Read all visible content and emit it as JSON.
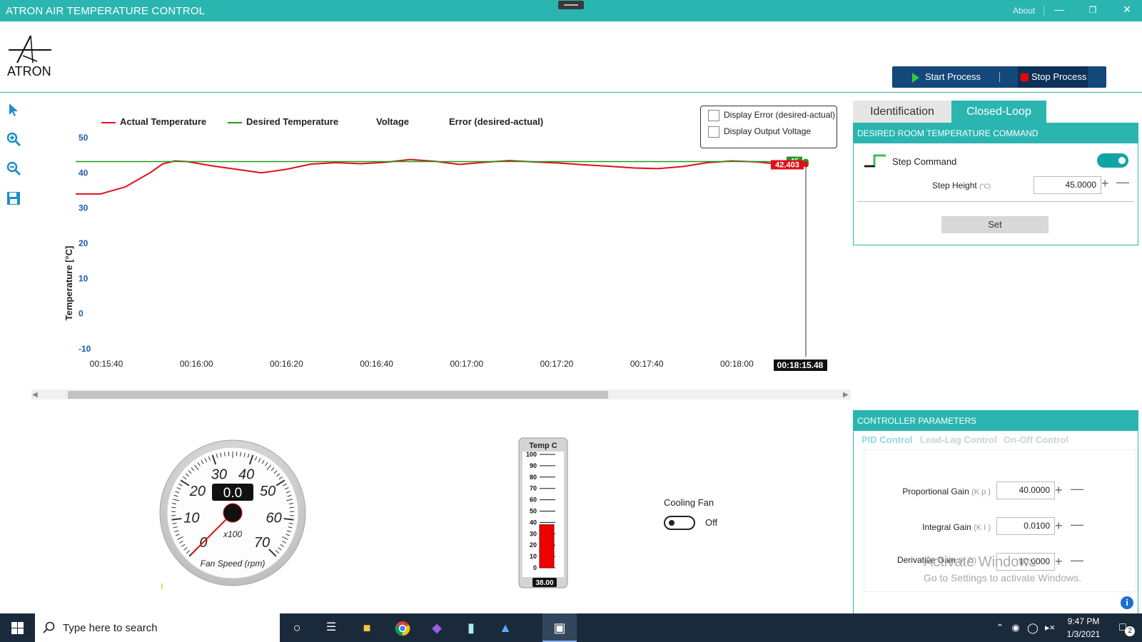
{
  "window": {
    "title": "ATRON AIR TEMPERATURE CONTROL",
    "about_label": "About"
  },
  "header": {
    "logo_text": "ATRON",
    "start_label": "Start Process",
    "stop_label": "Stop Process"
  },
  "toolbar": {
    "icons": [
      "pointer-icon",
      "zoom-in-icon",
      "zoom-out-icon",
      "save-icon"
    ]
  },
  "chart_data": {
    "type": "line",
    "ylabel": "Temperature [°C]",
    "xlabel": "",
    "ylim": [
      -10,
      50
    ],
    "yticks": [
      "50",
      "40",
      "30",
      "20",
      "10",
      "0",
      "-10"
    ],
    "xticks": [
      "00:15:40",
      "00:16:00",
      "00:16:20",
      "00:16:40",
      "00:17:00",
      "00:17:20",
      "00:17:40",
      "00:18:00"
    ],
    "cursor_time": "00:18:15.48",
    "legend": [
      "Actual Temperature",
      "Desired Temperature",
      "Voltage",
      "Error (desired-actual)"
    ],
    "colors": {
      "actual": "#e0101a",
      "desired": "#1e9b1e"
    },
    "series": [
      {
        "name": "Actual Temperature",
        "points": [
          [
            0,
            34
          ],
          [
            10,
            34
          ],
          [
            20,
            36
          ],
          [
            30,
            40
          ],
          [
            35,
            42.5
          ],
          [
            40,
            43.4
          ],
          [
            45,
            43.2
          ],
          [
            55,
            42
          ],
          [
            65,
            41
          ],
          [
            75,
            40
          ],
          [
            85,
            41
          ],
          [
            95,
            42.5
          ],
          [
            105,
            42.9
          ],
          [
            115,
            42.6
          ],
          [
            125,
            43
          ],
          [
            135,
            43.8
          ],
          [
            145,
            43.3
          ],
          [
            155,
            42.4
          ],
          [
            165,
            43
          ],
          [
            175,
            43.5
          ],
          [
            185,
            43.1
          ],
          [
            195,
            42.8
          ],
          [
            205,
            42.3
          ],
          [
            215,
            41.9
          ],
          [
            225,
            41.4
          ],
          [
            235,
            41.2
          ],
          [
            245,
            41.8
          ],
          [
            255,
            42.9
          ],
          [
            265,
            43.4
          ],
          [
            275,
            43.1
          ],
          [
            285,
            42.4
          ],
          [
            295,
            42.4
          ]
        ]
      },
      {
        "name": "Desired Temperature",
        "points": [
          [
            0,
            43.2
          ],
          [
            295,
            43.2
          ]
        ]
      }
    ],
    "actual_value_label": "42.403",
    "desired_value_label": "45"
  },
  "chart_options": {
    "display_error_label": "Display Error (desired-actual)",
    "display_voltage_label": "Display Output Voltage"
  },
  "right_panel": {
    "tabs": [
      "Identification",
      "Closed-Loop"
    ],
    "desired_header": "DESIRED ROOM TEMPERATURE COMMAND",
    "step_command_label": "Step Command",
    "step_height_label": "Step Height",
    "step_height_unit": "(°C)",
    "step_height_value": "45.0000",
    "set_label": "Set",
    "controller_header": "CONTROLLER PARAMETERS",
    "subtabs": [
      "PID Control",
      "Lead-Lag Control",
      "On-Off Control"
    ],
    "params": [
      {
        "label": "Proportional Gain",
        "symbol": "(K p )",
        "value": "40.0000"
      },
      {
        "label": "Integral Gain",
        "symbol": "(K I )",
        "value": "0.0100"
      },
      {
        "label": "Derivative Gain",
        "symbol": "(K D)",
        "value": "10.0000"
      }
    ]
  },
  "gauge": {
    "value": "0.0",
    "scale_labels": [
      "0",
      "10",
      "20",
      "30",
      "40",
      "50",
      "60",
      "70"
    ],
    "multiplier": "x100",
    "label": "Fan Speed (rpm)",
    "max": 70,
    "reading": 0
  },
  "thermometer": {
    "title": "Temp C",
    "scale": [
      "100",
      "90",
      "80",
      "70",
      "60",
      "50",
      "40",
      "30",
      "20",
      "10",
      "0"
    ],
    "value": "38.00",
    "level": 38
  },
  "cooling_fan": {
    "label": "Cooling Fan",
    "state": "Off"
  },
  "watermark": {
    "line1": "Activate Windows",
    "line2": "Go to Settings to activate Windows."
  },
  "taskbar": {
    "search_placeholder": "Type here to search",
    "time": "9:47 PM",
    "date": "1/3/2021",
    "notification_count": "2"
  }
}
